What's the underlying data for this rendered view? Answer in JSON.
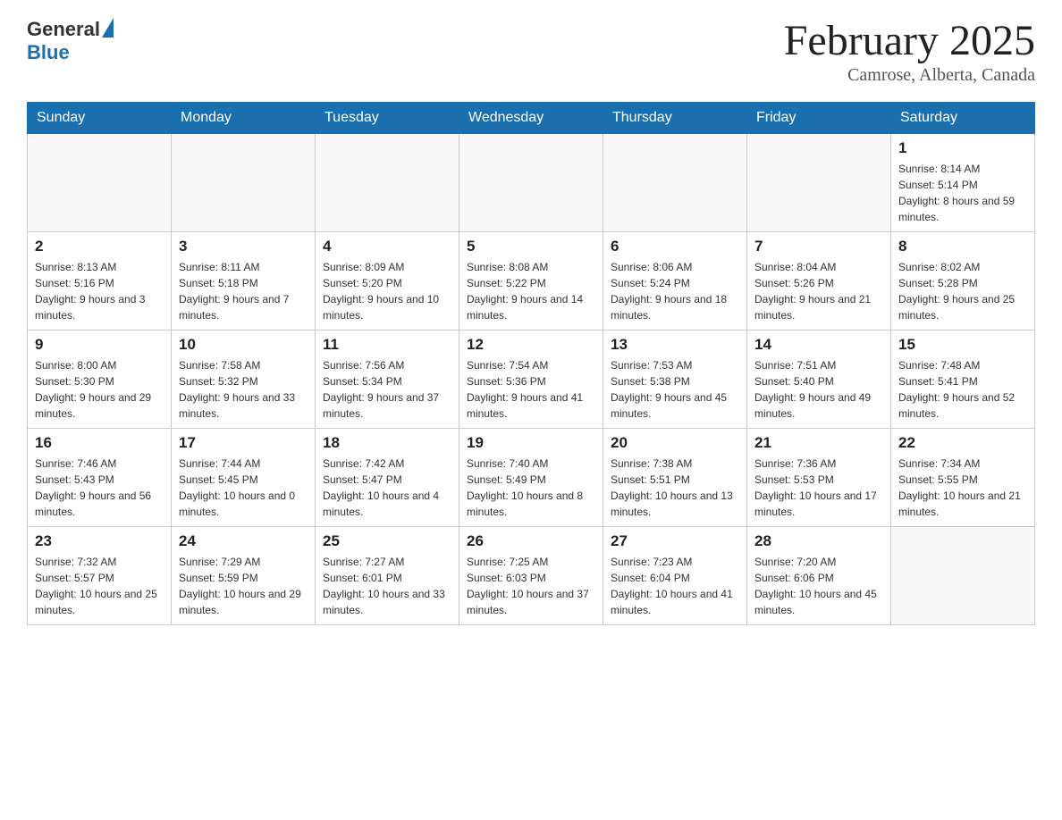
{
  "header": {
    "logo_general": "General",
    "logo_blue": "Blue",
    "month_title": "February 2025",
    "location": "Camrose, Alberta, Canada"
  },
  "days_of_week": [
    "Sunday",
    "Monday",
    "Tuesday",
    "Wednesday",
    "Thursday",
    "Friday",
    "Saturday"
  ],
  "weeks": [
    {
      "days": [
        {
          "number": "",
          "info": ""
        },
        {
          "number": "",
          "info": ""
        },
        {
          "number": "",
          "info": ""
        },
        {
          "number": "",
          "info": ""
        },
        {
          "number": "",
          "info": ""
        },
        {
          "number": "",
          "info": ""
        },
        {
          "number": "1",
          "info": "Sunrise: 8:14 AM\nSunset: 5:14 PM\nDaylight: 8 hours and 59 minutes."
        }
      ]
    },
    {
      "days": [
        {
          "number": "2",
          "info": "Sunrise: 8:13 AM\nSunset: 5:16 PM\nDaylight: 9 hours and 3 minutes."
        },
        {
          "number": "3",
          "info": "Sunrise: 8:11 AM\nSunset: 5:18 PM\nDaylight: 9 hours and 7 minutes."
        },
        {
          "number": "4",
          "info": "Sunrise: 8:09 AM\nSunset: 5:20 PM\nDaylight: 9 hours and 10 minutes."
        },
        {
          "number": "5",
          "info": "Sunrise: 8:08 AM\nSunset: 5:22 PM\nDaylight: 9 hours and 14 minutes."
        },
        {
          "number": "6",
          "info": "Sunrise: 8:06 AM\nSunset: 5:24 PM\nDaylight: 9 hours and 18 minutes."
        },
        {
          "number": "7",
          "info": "Sunrise: 8:04 AM\nSunset: 5:26 PM\nDaylight: 9 hours and 21 minutes."
        },
        {
          "number": "8",
          "info": "Sunrise: 8:02 AM\nSunset: 5:28 PM\nDaylight: 9 hours and 25 minutes."
        }
      ]
    },
    {
      "days": [
        {
          "number": "9",
          "info": "Sunrise: 8:00 AM\nSunset: 5:30 PM\nDaylight: 9 hours and 29 minutes."
        },
        {
          "number": "10",
          "info": "Sunrise: 7:58 AM\nSunset: 5:32 PM\nDaylight: 9 hours and 33 minutes."
        },
        {
          "number": "11",
          "info": "Sunrise: 7:56 AM\nSunset: 5:34 PM\nDaylight: 9 hours and 37 minutes."
        },
        {
          "number": "12",
          "info": "Sunrise: 7:54 AM\nSunset: 5:36 PM\nDaylight: 9 hours and 41 minutes."
        },
        {
          "number": "13",
          "info": "Sunrise: 7:53 AM\nSunset: 5:38 PM\nDaylight: 9 hours and 45 minutes."
        },
        {
          "number": "14",
          "info": "Sunrise: 7:51 AM\nSunset: 5:40 PM\nDaylight: 9 hours and 49 minutes."
        },
        {
          "number": "15",
          "info": "Sunrise: 7:48 AM\nSunset: 5:41 PM\nDaylight: 9 hours and 52 minutes."
        }
      ]
    },
    {
      "days": [
        {
          "number": "16",
          "info": "Sunrise: 7:46 AM\nSunset: 5:43 PM\nDaylight: 9 hours and 56 minutes."
        },
        {
          "number": "17",
          "info": "Sunrise: 7:44 AM\nSunset: 5:45 PM\nDaylight: 10 hours and 0 minutes."
        },
        {
          "number": "18",
          "info": "Sunrise: 7:42 AM\nSunset: 5:47 PM\nDaylight: 10 hours and 4 minutes."
        },
        {
          "number": "19",
          "info": "Sunrise: 7:40 AM\nSunset: 5:49 PM\nDaylight: 10 hours and 8 minutes."
        },
        {
          "number": "20",
          "info": "Sunrise: 7:38 AM\nSunset: 5:51 PM\nDaylight: 10 hours and 13 minutes."
        },
        {
          "number": "21",
          "info": "Sunrise: 7:36 AM\nSunset: 5:53 PM\nDaylight: 10 hours and 17 minutes."
        },
        {
          "number": "22",
          "info": "Sunrise: 7:34 AM\nSunset: 5:55 PM\nDaylight: 10 hours and 21 minutes."
        }
      ]
    },
    {
      "days": [
        {
          "number": "23",
          "info": "Sunrise: 7:32 AM\nSunset: 5:57 PM\nDaylight: 10 hours and 25 minutes."
        },
        {
          "number": "24",
          "info": "Sunrise: 7:29 AM\nSunset: 5:59 PM\nDaylight: 10 hours and 29 minutes."
        },
        {
          "number": "25",
          "info": "Sunrise: 7:27 AM\nSunset: 6:01 PM\nDaylight: 10 hours and 33 minutes."
        },
        {
          "number": "26",
          "info": "Sunrise: 7:25 AM\nSunset: 6:03 PM\nDaylight: 10 hours and 37 minutes."
        },
        {
          "number": "27",
          "info": "Sunrise: 7:23 AM\nSunset: 6:04 PM\nDaylight: 10 hours and 41 minutes."
        },
        {
          "number": "28",
          "info": "Sunrise: 7:20 AM\nSunset: 6:06 PM\nDaylight: 10 hours and 45 minutes."
        },
        {
          "number": "",
          "info": ""
        }
      ]
    }
  ]
}
